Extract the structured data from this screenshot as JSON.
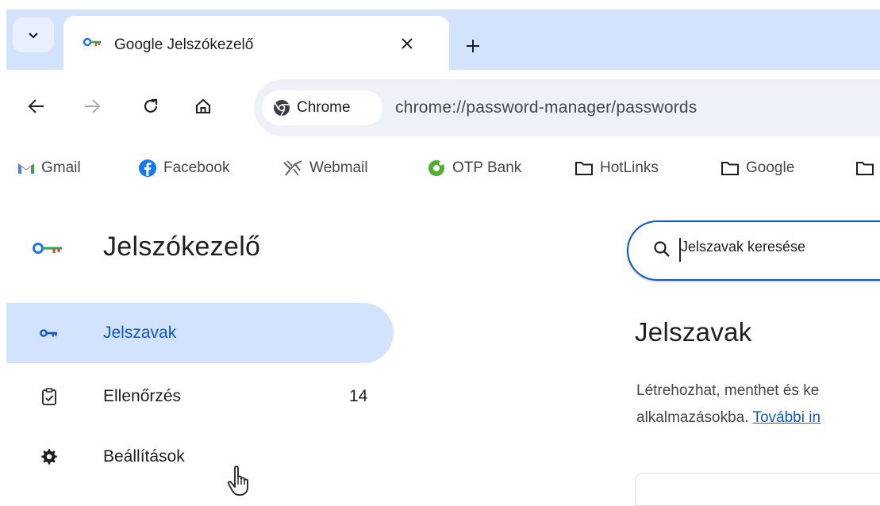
{
  "browser": {
    "tab": {
      "title": "Google Jelszókezelő"
    },
    "address_bar": {
      "chip_label": "Chrome",
      "url": "chrome://password-manager/passwords"
    },
    "bookmarks": [
      {
        "label": "Gmail",
        "icon": "gmail-icon"
      },
      {
        "label": "Facebook",
        "icon": "facebook-icon"
      },
      {
        "label": "Webmail",
        "icon": "webmail-icon"
      },
      {
        "label": "OTP Bank",
        "icon": "otp-bank-icon"
      },
      {
        "label": "HotLinks",
        "icon": "folder-icon"
      },
      {
        "label": "Google",
        "icon": "folder-icon"
      }
    ]
  },
  "sidebar": {
    "title": "Jelszókezelő",
    "items": [
      {
        "label": "Jelszavak",
        "icon": "key-icon",
        "active": true
      },
      {
        "label": "Ellenőrzés",
        "icon": "checkup-icon",
        "count": "14"
      },
      {
        "label": "Beállítások",
        "icon": "gear-icon"
      }
    ]
  },
  "main": {
    "search": {
      "placeholder": "Jelszavak keresése"
    },
    "title": "Jelszavak",
    "description_line1": "Létrehozhat, menthet és ke",
    "description_line2_prefix": "alkalmazásokba. ",
    "description_link": "További in"
  },
  "colors": {
    "accent": "#0b57d0",
    "tabstrip_bg": "#d3e3fd",
    "active_nav_bg": "#d3e3fd",
    "omnibox_bg": "#eef2f8"
  }
}
